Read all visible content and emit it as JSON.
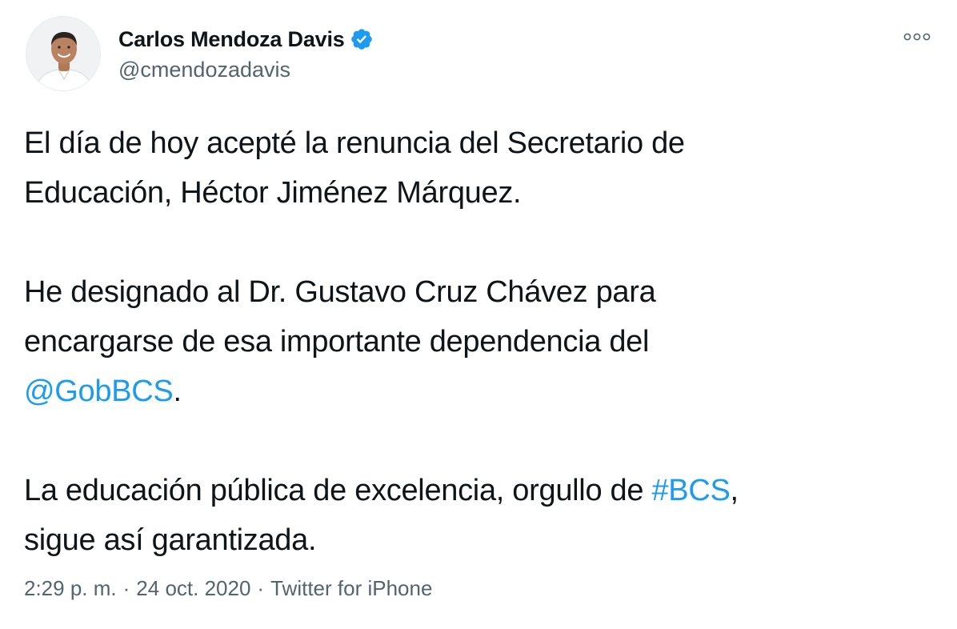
{
  "author": {
    "display_name": "Carlos Mendoza Davis",
    "handle": "@cmendozadavis",
    "verified": true
  },
  "icons": {
    "verified": "verified-badge-icon",
    "more": "more-horizontal-icon"
  },
  "tweet": {
    "p1_line1": "El día de hoy acepté la renuncia del Secretario de",
    "p1_line2": "Educación, Héctor Jiménez Márquez.",
    "p2_line1": "He designado al Dr. Gustavo Cruz Chávez para",
    "p2_line2": "encargarse de esa importante dependencia del",
    "p2_mention": "@GobBCS",
    "p2_end": ".",
    "p3_line1_pre": "La educación pública de excelencia, orgullo de ",
    "p3_hashtag": "#BCS",
    "p3_line1_post": ",",
    "p3_line2": "sigue así garantizada."
  },
  "meta": {
    "time": "2:29 p. m.",
    "separator": "·",
    "date": "24 oct. 2020",
    "source": "Twitter for iPhone"
  },
  "colors": {
    "link": "#1d9bf0",
    "secondary_text": "#536471",
    "primary_text": "#0f1419",
    "verified": "#1d9bf0"
  }
}
